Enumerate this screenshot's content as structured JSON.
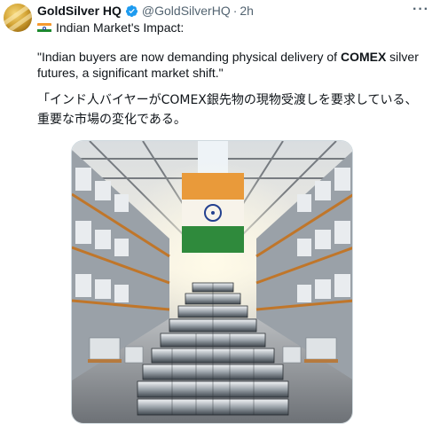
{
  "tweet": {
    "display_name": "GoldSilver HQ",
    "handle": "@GoldSilverHQ",
    "separator": "·",
    "time": "2h",
    "more_icon": "more-icon",
    "verified_icon": "verified-badge-icon",
    "headline": "Indian Market's Impact:",
    "headline_icon": "india-flag-icon",
    "quote_before": "\"Indian buyers are now demanding physical delivery of ",
    "quote_bold": "COMEX",
    "quote_after": " silver futures, a significant market shift.\"",
    "translation": "「インド人バイヤーがCOMEX銀先物の現物受渡しを要求している、 重要な市場の変化である。",
    "media_description_icon": "warehouse-silver-bars-image"
  },
  "colors": {
    "verified": "#1d9bf0",
    "secondary_text": "#536471",
    "primary_text": "#0f1419"
  }
}
